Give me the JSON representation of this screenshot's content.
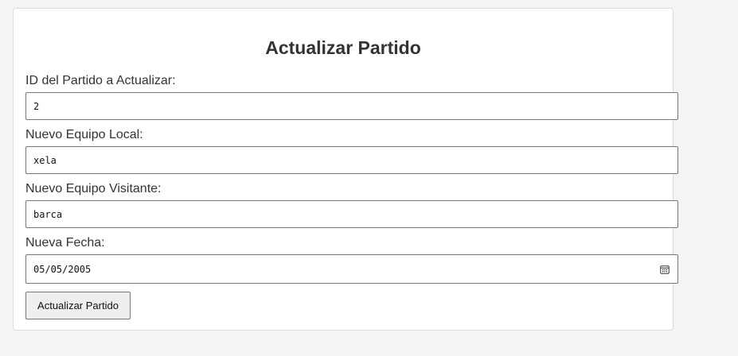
{
  "form": {
    "title": "Actualizar Partido",
    "fields": [
      {
        "label": "ID del Partido a Actualizar:",
        "value": "2"
      },
      {
        "label": "Nuevo Equipo Local:",
        "value": "xela"
      },
      {
        "label": "Nuevo Equipo Visitante:",
        "value": "barca"
      },
      {
        "label": "Nueva Fecha:",
        "value": "05/05/2005",
        "icon": "calendar-icon"
      }
    ],
    "submit_label": "Actualizar Partido"
  },
  "colors": {
    "page_background": "#f4f4f4",
    "card_background": "#ffffff",
    "text": "#333333",
    "button_background": "#efefef"
  }
}
